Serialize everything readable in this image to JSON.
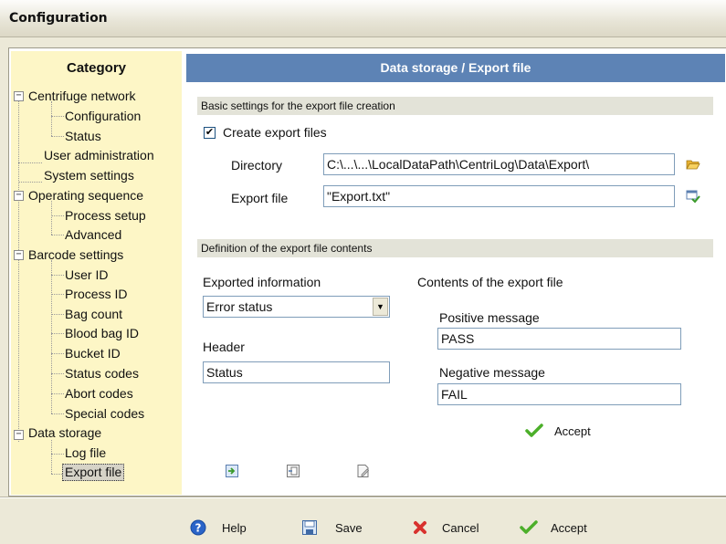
{
  "window": {
    "title": "Configuration"
  },
  "sidebar": {
    "heading": "Category",
    "items": [
      {
        "label": "Centrifuge network",
        "level": 0,
        "expander": "−"
      },
      {
        "label": "Configuration",
        "level": 1
      },
      {
        "label": "Status",
        "level": 1
      },
      {
        "label": "User administration",
        "level": 0
      },
      {
        "label": "System settings",
        "level": 0
      },
      {
        "label": "Operating sequence",
        "level": 0,
        "expander": "−"
      },
      {
        "label": "Process setup",
        "level": 1
      },
      {
        "label": "Advanced",
        "level": 1
      },
      {
        "label": "Barcode settings",
        "level": 0,
        "expander": "−"
      },
      {
        "label": "User ID",
        "level": 1
      },
      {
        "label": "Process ID",
        "level": 1
      },
      {
        "label": "Bag count",
        "level": 1
      },
      {
        "label": "Blood bag ID",
        "level": 1
      },
      {
        "label": "Bucket ID",
        "level": 1
      },
      {
        "label": "Status codes",
        "level": 1
      },
      {
        "label": "Abort codes",
        "level": 1
      },
      {
        "label": "Special codes",
        "level": 1
      },
      {
        "label": "Data storage",
        "level": 0,
        "expander": "−"
      },
      {
        "label": "Log file",
        "level": 1
      },
      {
        "label": "Export file",
        "level": 1,
        "selected": true
      }
    ]
  },
  "panel": {
    "title": "Data storage / Export file",
    "basic": {
      "section_label": "Basic settings for the export file creation",
      "create_checked": "✔",
      "create_label": "Create export files",
      "directory_label": "Directory",
      "directory_value": "C:\\...\\...\\LocalDataPath\\CentriLog\\Data\\Export\\",
      "export_file_label": "Export file",
      "export_file_value": "\"Export.txt\""
    },
    "contents": {
      "section_label": "Definition of the export file contents",
      "exported_info_label": "Exported information",
      "exported_info_value": "Error status",
      "header_label": "Header",
      "header_value": "Status",
      "file_contents_label": "Contents of the export file",
      "positive_label": "Positive message",
      "positive_value": "PASS",
      "negative_label": "Negative message",
      "negative_value": "FAIL",
      "accept_label": "Accept"
    }
  },
  "footer": {
    "help": "Help",
    "save": "Save",
    "cancel": "Cancel",
    "accept": "Accept"
  },
  "colors": {
    "panel_header": "#5d83b5",
    "sidebar_bg": "#fdf6c6",
    "accept_green": "#4caf2a",
    "cancel_red": "#d8322e",
    "help_blue": "#2a64c8"
  }
}
